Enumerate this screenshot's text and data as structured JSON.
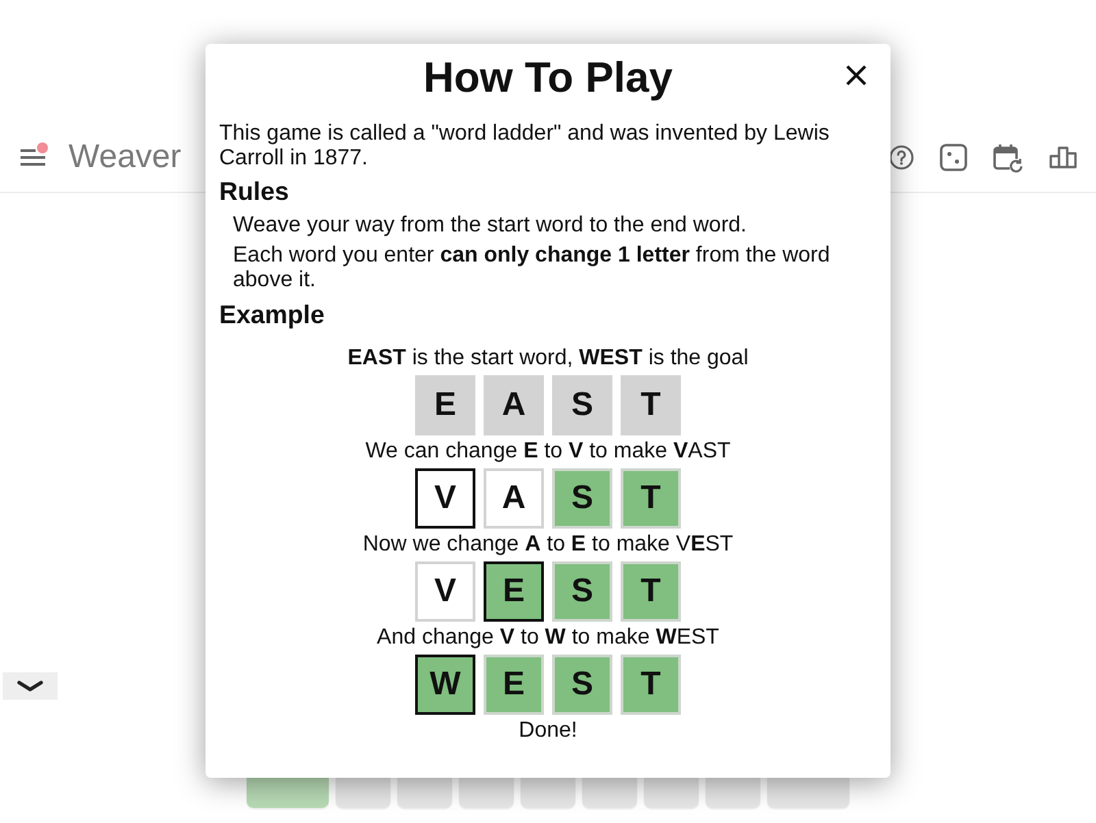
{
  "header": {
    "title": "Weaver",
    "notification": true
  },
  "dialog": {
    "title": "How To Play",
    "intro": "This game is called a \"word ladder\" and was invented by Lewis Carroll in 1877.",
    "rules": {
      "heading": "Rules",
      "items": [
        "Weave your way from the start word to the end word.",
        "Each word you enter **can only change 1 letter** from the word above it."
      ]
    },
    "example": {
      "heading": "Example",
      "steps": [
        {
          "caption": "**EAST** is the start word, **WEST** is the goal",
          "tiles": [
            {
              "letter": "E",
              "kind": "start",
              "changed": false
            },
            {
              "letter": "A",
              "kind": "start",
              "changed": false
            },
            {
              "letter": "S",
              "kind": "start",
              "changed": false
            },
            {
              "letter": "T",
              "kind": "start",
              "changed": false
            }
          ]
        },
        {
          "caption": "We can change **E** to **V** to make **V**AST",
          "tiles": [
            {
              "letter": "V",
              "kind": "miss",
              "changed": true
            },
            {
              "letter": "A",
              "kind": "miss",
              "changed": false
            },
            {
              "letter": "S",
              "kind": "match",
              "changed": false
            },
            {
              "letter": "T",
              "kind": "match",
              "changed": false
            }
          ]
        },
        {
          "caption": "Now we change **A** to **E** to make V**E**ST",
          "tiles": [
            {
              "letter": "V",
              "kind": "miss",
              "changed": false
            },
            {
              "letter": "E",
              "kind": "match",
              "changed": true
            },
            {
              "letter": "S",
              "kind": "match",
              "changed": false
            },
            {
              "letter": "T",
              "kind": "match",
              "changed": false
            }
          ]
        },
        {
          "caption": "And change **V** to **W** to make **W**EST",
          "tiles": [
            {
              "letter": "W",
              "kind": "match",
              "changed": true
            },
            {
              "letter": "E",
              "kind": "match",
              "changed": false
            },
            {
              "letter": "S",
              "kind": "match",
              "changed": false
            },
            {
              "letter": "T",
              "kind": "match",
              "changed": false
            }
          ]
        }
      ],
      "closing": "Done!"
    }
  },
  "keyboard": {
    "keys": [
      {
        "kind": "wide",
        "color": "#b7dab4"
      },
      {
        "kind": "letter",
        "color": "#e6e6e6"
      },
      {
        "kind": "letter",
        "color": "#e6e6e6"
      },
      {
        "kind": "letter",
        "color": "#e6e6e6"
      },
      {
        "kind": "letter",
        "color": "#e6e6e6"
      },
      {
        "kind": "letter",
        "color": "#e6e6e6"
      },
      {
        "kind": "letter",
        "color": "#e6e6e6"
      },
      {
        "kind": "letter",
        "color": "#e6e6e6"
      },
      {
        "kind": "wide",
        "color": "#e6e6e6"
      }
    ]
  }
}
